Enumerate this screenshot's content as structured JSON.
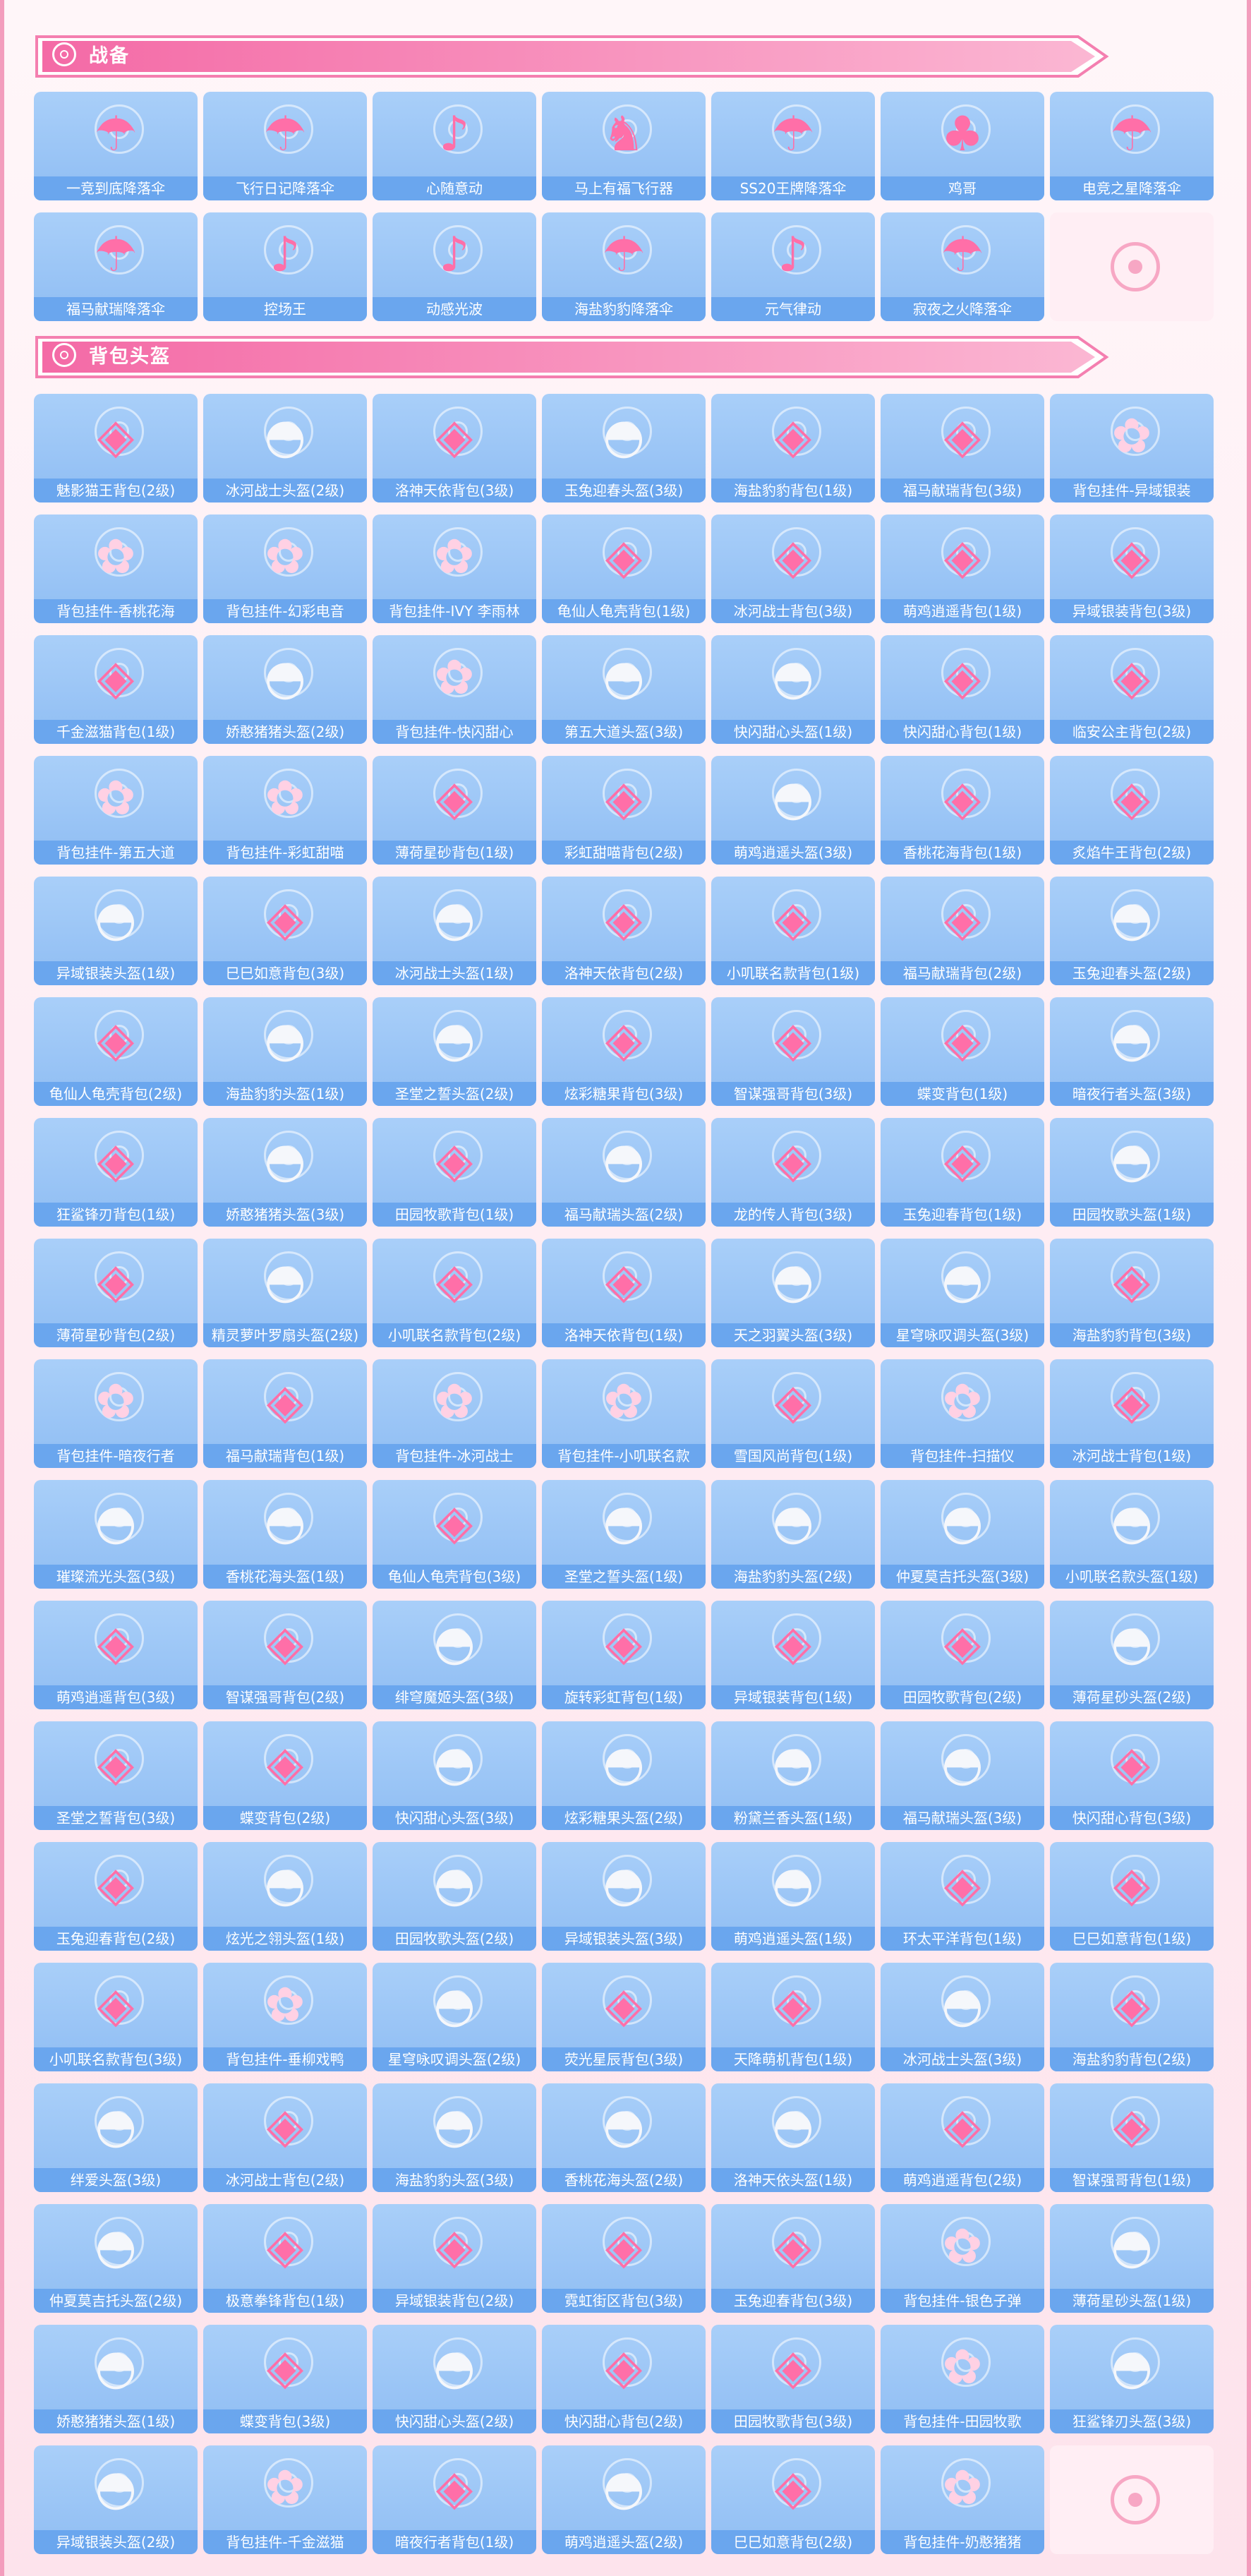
{
  "sections": [
    {
      "title": "战备",
      "items": [
        {
          "label": "一竞到底降落伞",
          "icon": "parachute-icon"
        },
        {
          "label": "飞行日记降落伞",
          "icon": "parachute-icon"
        },
        {
          "label": "心随意动",
          "icon": "dance-icon"
        },
        {
          "label": "马上有福飞行器",
          "icon": "horse-icon"
        },
        {
          "label": "SS20王牌降落伞",
          "icon": "parachute-icon"
        },
        {
          "label": "鸡哥",
          "icon": "chicken-icon"
        },
        {
          "label": "电竞之星降落伞",
          "icon": "parachute-icon"
        },
        {
          "label": "福马献瑞降落伞",
          "icon": "parachute-icon"
        },
        {
          "label": "控场王",
          "icon": "dance-icon"
        },
        {
          "label": "动感光波",
          "icon": "dance-icon"
        },
        {
          "label": "海盐豹豹降落伞",
          "icon": "parachute-icon"
        },
        {
          "label": "元气律动",
          "icon": "dance-icon"
        },
        {
          "label": "寂夜之火降落伞",
          "icon": "parachute-icon"
        }
      ]
    },
    {
      "title": "背包头盔",
      "items": [
        {
          "label": "魅影猫王背包(2级)",
          "icon": "backpack-icon"
        },
        {
          "label": "冰河战士头盔(2级)",
          "icon": "helmet-icon"
        },
        {
          "label": "洛神天依背包(3级)",
          "icon": "backpack-icon"
        },
        {
          "label": "玉兔迎春头盔(3级)",
          "icon": "helmet-icon"
        },
        {
          "label": "海盐豹豹背包(1级)",
          "icon": "backpack-icon"
        },
        {
          "label": "福马献瑞背包(3级)",
          "icon": "backpack-icon"
        },
        {
          "label": "背包挂件-异域银装",
          "icon": "charm-icon"
        },
        {
          "label": "背包挂件-香桃花海",
          "icon": "charm-icon"
        },
        {
          "label": "背包挂件-幻彩电音",
          "icon": "charm-icon"
        },
        {
          "label": "背包挂件-IVY 李雨林",
          "icon": "charm-icon"
        },
        {
          "label": "龟仙人龟壳背包(1级)",
          "icon": "backpack-icon"
        },
        {
          "label": "冰河战士背包(3级)",
          "icon": "backpack-icon"
        },
        {
          "label": "萌鸡逍遥背包(1级)",
          "icon": "backpack-icon"
        },
        {
          "label": "异域银装背包(3级)",
          "icon": "backpack-icon"
        },
        {
          "label": "千金滋猫背包(1级)",
          "icon": "backpack-icon"
        },
        {
          "label": "娇憨猪猪头盔(2级)",
          "icon": "helmet-icon"
        },
        {
          "label": "背包挂件-快闪甜心",
          "icon": "charm-icon"
        },
        {
          "label": "第五大道头盔(3级)",
          "icon": "helmet-icon"
        },
        {
          "label": "快闪甜心头盔(1级)",
          "icon": "helmet-icon"
        },
        {
          "label": "快闪甜心背包(1级)",
          "icon": "backpack-icon"
        },
        {
          "label": "临安公主背包(2级)",
          "icon": "backpack-icon"
        },
        {
          "label": "背包挂件-第五大道",
          "icon": "charm-icon"
        },
        {
          "label": "背包挂件-彩虹甜喵",
          "icon": "charm-icon"
        },
        {
          "label": "薄荷星砂背包(1级)",
          "icon": "backpack-icon"
        },
        {
          "label": "彩虹甜喵背包(2级)",
          "icon": "backpack-icon"
        },
        {
          "label": "萌鸡逍遥头盔(3级)",
          "icon": "helmet-icon"
        },
        {
          "label": "香桃花海背包(1级)",
          "icon": "backpack-icon"
        },
        {
          "label": "炙焰牛王背包(2级)",
          "icon": "backpack-icon"
        },
        {
          "label": "异域银装头盔(1级)",
          "icon": "helmet-icon"
        },
        {
          "label": "巳巳如意背包(3级)",
          "icon": "backpack-icon"
        },
        {
          "label": "冰河战士头盔(1级)",
          "icon": "helmet-icon"
        },
        {
          "label": "洛神天依背包(2级)",
          "icon": "backpack-icon"
        },
        {
          "label": "小叽联名款背包(1级)",
          "icon": "backpack-icon"
        },
        {
          "label": "福马献瑞背包(2级)",
          "icon": "backpack-icon"
        },
        {
          "label": "玉兔迎春头盔(2级)",
          "icon": "helmet-icon"
        },
        {
          "label": "龟仙人龟壳背包(2级)",
          "icon": "backpack-icon"
        },
        {
          "label": "海盐豹豹头盔(1级)",
          "icon": "helmet-icon"
        },
        {
          "label": "圣堂之誓头盔(2级)",
          "icon": "helmet-icon"
        },
        {
          "label": "炫彩糖果背包(3级)",
          "icon": "backpack-icon"
        },
        {
          "label": "智谋强哥背包(3级)",
          "icon": "backpack-icon"
        },
        {
          "label": "蝶变背包(1级)",
          "icon": "backpack-icon"
        },
        {
          "label": "暗夜行者头盔(3级)",
          "icon": "helmet-icon"
        },
        {
          "label": "狂鲨锋刃背包(1级)",
          "icon": "backpack-icon"
        },
        {
          "label": "娇憨猪猪头盔(3级)",
          "icon": "helmet-icon"
        },
        {
          "label": "田园牧歌背包(1级)",
          "icon": "backpack-icon"
        },
        {
          "label": "福马献瑞头盔(2级)",
          "icon": "helmet-icon"
        },
        {
          "label": "龙的传人背包(3级)",
          "icon": "backpack-icon"
        },
        {
          "label": "玉兔迎春背包(1级)",
          "icon": "backpack-icon"
        },
        {
          "label": "田园牧歌头盔(1级)",
          "icon": "helmet-icon"
        },
        {
          "label": "薄荷星砂背包(2级)",
          "icon": "backpack-icon"
        },
        {
          "label": "精灵萝叶罗扇头盔(2级)",
          "icon": "helmet-icon"
        },
        {
          "label": "小叽联名款背包(2级)",
          "icon": "backpack-icon"
        },
        {
          "label": "洛神天依背包(1级)",
          "icon": "backpack-icon"
        },
        {
          "label": "天之羽翼头盔(3级)",
          "icon": "helmet-icon"
        },
        {
          "label": "星穹咏叹调头盔(3级)",
          "icon": "helmet-icon"
        },
        {
          "label": "海盐豹豹背包(3级)",
          "icon": "backpack-icon"
        },
        {
          "label": "背包挂件-暗夜行者",
          "icon": "charm-icon"
        },
        {
          "label": "福马献瑞背包(1级)",
          "icon": "backpack-icon"
        },
        {
          "label": "背包挂件-冰河战士",
          "icon": "charm-icon"
        },
        {
          "label": "背包挂件-小叽联名款",
          "icon": "charm-icon"
        },
        {
          "label": "雪国风尚背包(1级)",
          "icon": "backpack-icon"
        },
        {
          "label": "背包挂件-扫描仪",
          "icon": "charm-icon"
        },
        {
          "label": "冰河战士背包(1级)",
          "icon": "backpack-icon"
        },
        {
          "label": "璀璨流光头盔(3级)",
          "icon": "helmet-icon"
        },
        {
          "label": "香桃花海头盔(1级)",
          "icon": "helmet-icon"
        },
        {
          "label": "龟仙人龟壳背包(3级)",
          "icon": "backpack-icon"
        },
        {
          "label": "圣堂之誓头盔(1级)",
          "icon": "helmet-icon"
        },
        {
          "label": "海盐豹豹头盔(2级)",
          "icon": "helmet-icon"
        },
        {
          "label": "仲夏莫吉托头盔(3级)",
          "icon": "helmet-icon"
        },
        {
          "label": "小叽联名款头盔(1级)",
          "icon": "helmet-icon"
        },
        {
          "label": "萌鸡逍遥背包(3级)",
          "icon": "backpack-icon"
        },
        {
          "label": "智谋强哥背包(2级)",
          "icon": "backpack-icon"
        },
        {
          "label": "绯穹魔姬头盔(3级)",
          "icon": "helmet-icon"
        },
        {
          "label": "旋转彩虹背包(1级)",
          "icon": "backpack-icon"
        },
        {
          "label": "异域银装背包(1级)",
          "icon": "backpack-icon"
        },
        {
          "label": "田园牧歌背包(2级)",
          "icon": "backpack-icon"
        },
        {
          "label": "薄荷星砂头盔(2级)",
          "icon": "helmet-icon"
        },
        {
          "label": "圣堂之誓背包(3级)",
          "icon": "backpack-icon"
        },
        {
          "label": "蝶变背包(2级)",
          "icon": "backpack-icon"
        },
        {
          "label": "快闪甜心头盔(3级)",
          "icon": "helmet-icon"
        },
        {
          "label": "炫彩糖果头盔(2级)",
          "icon": "helmet-icon"
        },
        {
          "label": "粉黛兰香头盔(1级)",
          "icon": "helmet-icon"
        },
        {
          "label": "福马献瑞头盔(3级)",
          "icon": "helmet-icon"
        },
        {
          "label": "快闪甜心背包(3级)",
          "icon": "backpack-icon"
        },
        {
          "label": "玉兔迎春背包(2级)",
          "icon": "backpack-icon"
        },
        {
          "label": "炫光之翎头盔(1级)",
          "icon": "helmet-icon"
        },
        {
          "label": "田园牧歌头盔(2级)",
          "icon": "helmet-icon"
        },
        {
          "label": "异域银装头盔(3级)",
          "icon": "helmet-icon"
        },
        {
          "label": "萌鸡逍遥头盔(1级)",
          "icon": "helmet-icon"
        },
        {
          "label": "环太平洋背包(1级)",
          "icon": "backpack-icon"
        },
        {
          "label": "巳巳如意背包(1级)",
          "icon": "backpack-icon"
        },
        {
          "label": "小叽联名款背包(3级)",
          "icon": "backpack-icon"
        },
        {
          "label": "背包挂件-垂柳戏鸭",
          "icon": "charm-icon"
        },
        {
          "label": "星穹咏叹调头盔(2级)",
          "icon": "helmet-icon"
        },
        {
          "label": "荧光星辰背包(3级)",
          "icon": "backpack-icon"
        },
        {
          "label": "天降萌机背包(1级)",
          "icon": "backpack-icon"
        },
        {
          "label": "冰河战士头盔(3级)",
          "icon": "helmet-icon"
        },
        {
          "label": "海盐豹豹背包(2级)",
          "icon": "backpack-icon"
        },
        {
          "label": "绊爱头盔(3级)",
          "icon": "helmet-icon"
        },
        {
          "label": "冰河战士背包(2级)",
          "icon": "backpack-icon"
        },
        {
          "label": "海盐豹豹头盔(3级)",
          "icon": "helmet-icon"
        },
        {
          "label": "香桃花海头盔(2级)",
          "icon": "helmet-icon"
        },
        {
          "label": "洛神天依头盔(1级)",
          "icon": "helmet-icon"
        },
        {
          "label": "萌鸡逍遥背包(2级)",
          "icon": "backpack-icon"
        },
        {
          "label": "智谋强哥背包(1级)",
          "icon": "backpack-icon"
        },
        {
          "label": "仲夏莫吉托头盔(2级)",
          "icon": "helmet-icon"
        },
        {
          "label": "极意拳锋背包(1级)",
          "icon": "backpack-icon"
        },
        {
          "label": "异域银装背包(2级)",
          "icon": "backpack-icon"
        },
        {
          "label": "霓虹街区背包(3级)",
          "icon": "backpack-icon"
        },
        {
          "label": "玉兔迎春背包(3级)",
          "icon": "backpack-icon"
        },
        {
          "label": "背包挂件-银色子弹",
          "icon": "charm-icon"
        },
        {
          "label": "薄荷星砂头盔(1级)",
          "icon": "helmet-icon"
        },
        {
          "label": "娇憨猪猪头盔(1级)",
          "icon": "helmet-icon"
        },
        {
          "label": "蝶变背包(3级)",
          "icon": "backpack-icon"
        },
        {
          "label": "快闪甜心头盔(2级)",
          "icon": "helmet-icon"
        },
        {
          "label": "快闪甜心背包(2级)",
          "icon": "backpack-icon"
        },
        {
          "label": "田园牧歌背包(3级)",
          "icon": "backpack-icon"
        },
        {
          "label": "背包挂件-田园牧歌",
          "icon": "charm-icon"
        },
        {
          "label": "狂鲨锋刃头盔(3级)",
          "icon": "helmet-icon"
        },
        {
          "label": "异域银装头盔(2级)",
          "icon": "helmet-icon"
        },
        {
          "label": "背包挂件-千金滋猫",
          "icon": "charm-icon"
        },
        {
          "label": "暗夜行者背包(1级)",
          "icon": "backpack-icon"
        },
        {
          "label": "萌鸡逍遥头盔(2级)",
          "icon": "helmet-icon"
        },
        {
          "label": "巳巳如意背包(2级)",
          "icon": "backpack-icon"
        },
        {
          "label": "背包挂件-奶憨猪猪",
          "icon": "charm-icon"
        }
      ]
    }
  ],
  "icon_glyphs": {
    "parachute-icon": "☂",
    "dance-icon": "♪",
    "horse-icon": "♞",
    "chicken-icon": "♣",
    "backpack-icon": "◈",
    "helmet-icon": "◓",
    "charm-icon": "✿"
  },
  "colors": {
    "card_bg": "#9cc6f6",
    "label_bg": "#6aa6ee",
    "banner": "#f47fb0",
    "accent": "#f39dbd"
  }
}
